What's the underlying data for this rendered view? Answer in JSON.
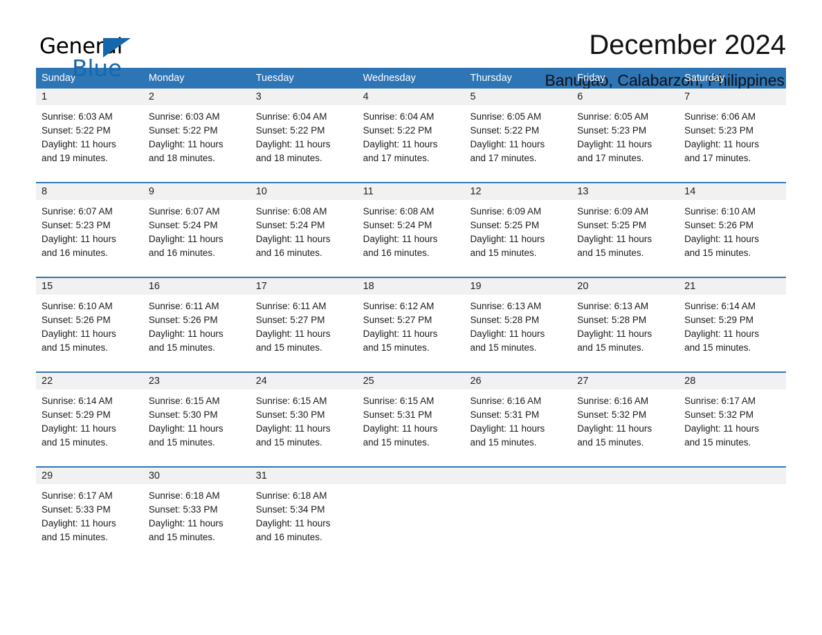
{
  "brand": {
    "name_part1": "General",
    "name_part2": "Blue",
    "triangle_color": "#1567ab",
    "blue_color": "#1569ae"
  },
  "header": {
    "title": "December 2024",
    "location": "Banugao, Calabarzon, Philippines"
  },
  "theme": {
    "header_blue": "#2e75b6",
    "date_band_gray": "#f1f1f1",
    "text_color": "#1a1a1a",
    "page_background": "#ffffff"
  },
  "calendar": {
    "weekdays": [
      "Sunday",
      "Monday",
      "Tuesday",
      "Wednesday",
      "Thursday",
      "Friday",
      "Saturday"
    ],
    "weeks": [
      [
        {
          "day": "1",
          "sunrise": "Sunrise: 6:03 AM",
          "sunset": "Sunset: 5:22 PM",
          "daylight_line1": "Daylight: 11 hours",
          "daylight_line2": "and 19 minutes."
        },
        {
          "day": "2",
          "sunrise": "Sunrise: 6:03 AM",
          "sunset": "Sunset: 5:22 PM",
          "daylight_line1": "Daylight: 11 hours",
          "daylight_line2": "and 18 minutes."
        },
        {
          "day": "3",
          "sunrise": "Sunrise: 6:04 AM",
          "sunset": "Sunset: 5:22 PM",
          "daylight_line1": "Daylight: 11 hours",
          "daylight_line2": "and 18 minutes."
        },
        {
          "day": "4",
          "sunrise": "Sunrise: 6:04 AM",
          "sunset": "Sunset: 5:22 PM",
          "daylight_line1": "Daylight: 11 hours",
          "daylight_line2": "and 17 minutes."
        },
        {
          "day": "5",
          "sunrise": "Sunrise: 6:05 AM",
          "sunset": "Sunset: 5:22 PM",
          "daylight_line1": "Daylight: 11 hours",
          "daylight_line2": "and 17 minutes."
        },
        {
          "day": "6",
          "sunrise": "Sunrise: 6:05 AM",
          "sunset": "Sunset: 5:23 PM",
          "daylight_line1": "Daylight: 11 hours",
          "daylight_line2": "and 17 minutes."
        },
        {
          "day": "7",
          "sunrise": "Sunrise: 6:06 AM",
          "sunset": "Sunset: 5:23 PM",
          "daylight_line1": "Daylight: 11 hours",
          "daylight_line2": "and 17 minutes."
        }
      ],
      [
        {
          "day": "8",
          "sunrise": "Sunrise: 6:07 AM",
          "sunset": "Sunset: 5:23 PM",
          "daylight_line1": "Daylight: 11 hours",
          "daylight_line2": "and 16 minutes."
        },
        {
          "day": "9",
          "sunrise": "Sunrise: 6:07 AM",
          "sunset": "Sunset: 5:24 PM",
          "daylight_line1": "Daylight: 11 hours",
          "daylight_line2": "and 16 minutes."
        },
        {
          "day": "10",
          "sunrise": "Sunrise: 6:08 AM",
          "sunset": "Sunset: 5:24 PM",
          "daylight_line1": "Daylight: 11 hours",
          "daylight_line2": "and 16 minutes."
        },
        {
          "day": "11",
          "sunrise": "Sunrise: 6:08 AM",
          "sunset": "Sunset: 5:24 PM",
          "daylight_line1": "Daylight: 11 hours",
          "daylight_line2": "and 16 minutes."
        },
        {
          "day": "12",
          "sunrise": "Sunrise: 6:09 AM",
          "sunset": "Sunset: 5:25 PM",
          "daylight_line1": "Daylight: 11 hours",
          "daylight_line2": "and 15 minutes."
        },
        {
          "day": "13",
          "sunrise": "Sunrise: 6:09 AM",
          "sunset": "Sunset: 5:25 PM",
          "daylight_line1": "Daylight: 11 hours",
          "daylight_line2": "and 15 minutes."
        },
        {
          "day": "14",
          "sunrise": "Sunrise: 6:10 AM",
          "sunset": "Sunset: 5:26 PM",
          "daylight_line1": "Daylight: 11 hours",
          "daylight_line2": "and 15 minutes."
        }
      ],
      [
        {
          "day": "15",
          "sunrise": "Sunrise: 6:10 AM",
          "sunset": "Sunset: 5:26 PM",
          "daylight_line1": "Daylight: 11 hours",
          "daylight_line2": "and 15 minutes."
        },
        {
          "day": "16",
          "sunrise": "Sunrise: 6:11 AM",
          "sunset": "Sunset: 5:26 PM",
          "daylight_line1": "Daylight: 11 hours",
          "daylight_line2": "and 15 minutes."
        },
        {
          "day": "17",
          "sunrise": "Sunrise: 6:11 AM",
          "sunset": "Sunset: 5:27 PM",
          "daylight_line1": "Daylight: 11 hours",
          "daylight_line2": "and 15 minutes."
        },
        {
          "day": "18",
          "sunrise": "Sunrise: 6:12 AM",
          "sunset": "Sunset: 5:27 PM",
          "daylight_line1": "Daylight: 11 hours",
          "daylight_line2": "and 15 minutes."
        },
        {
          "day": "19",
          "sunrise": "Sunrise: 6:13 AM",
          "sunset": "Sunset: 5:28 PM",
          "daylight_line1": "Daylight: 11 hours",
          "daylight_line2": "and 15 minutes."
        },
        {
          "day": "20",
          "sunrise": "Sunrise: 6:13 AM",
          "sunset": "Sunset: 5:28 PM",
          "daylight_line1": "Daylight: 11 hours",
          "daylight_line2": "and 15 minutes."
        },
        {
          "day": "21",
          "sunrise": "Sunrise: 6:14 AM",
          "sunset": "Sunset: 5:29 PM",
          "daylight_line1": "Daylight: 11 hours",
          "daylight_line2": "and 15 minutes."
        }
      ],
      [
        {
          "day": "22",
          "sunrise": "Sunrise: 6:14 AM",
          "sunset": "Sunset: 5:29 PM",
          "daylight_line1": "Daylight: 11 hours",
          "daylight_line2": "and 15 minutes."
        },
        {
          "day": "23",
          "sunrise": "Sunrise: 6:15 AM",
          "sunset": "Sunset: 5:30 PM",
          "daylight_line1": "Daylight: 11 hours",
          "daylight_line2": "and 15 minutes."
        },
        {
          "day": "24",
          "sunrise": "Sunrise: 6:15 AM",
          "sunset": "Sunset: 5:30 PM",
          "daylight_line1": "Daylight: 11 hours",
          "daylight_line2": "and 15 minutes."
        },
        {
          "day": "25",
          "sunrise": "Sunrise: 6:15 AM",
          "sunset": "Sunset: 5:31 PM",
          "daylight_line1": "Daylight: 11 hours",
          "daylight_line2": "and 15 minutes."
        },
        {
          "day": "26",
          "sunrise": "Sunrise: 6:16 AM",
          "sunset": "Sunset: 5:31 PM",
          "daylight_line1": "Daylight: 11 hours",
          "daylight_line2": "and 15 minutes."
        },
        {
          "day": "27",
          "sunrise": "Sunrise: 6:16 AM",
          "sunset": "Sunset: 5:32 PM",
          "daylight_line1": "Daylight: 11 hours",
          "daylight_line2": "and 15 minutes."
        },
        {
          "day": "28",
          "sunrise": "Sunrise: 6:17 AM",
          "sunset": "Sunset: 5:32 PM",
          "daylight_line1": "Daylight: 11 hours",
          "daylight_line2": "and 15 minutes."
        }
      ],
      [
        {
          "day": "29",
          "sunrise": "Sunrise: 6:17 AM",
          "sunset": "Sunset: 5:33 PM",
          "daylight_line1": "Daylight: 11 hours",
          "daylight_line2": "and 15 minutes."
        },
        {
          "day": "30",
          "sunrise": "Sunrise: 6:18 AM",
          "sunset": "Sunset: 5:33 PM",
          "daylight_line1": "Daylight: 11 hours",
          "daylight_line2": "and 15 minutes."
        },
        {
          "day": "31",
          "sunrise": "Sunrise: 6:18 AM",
          "sunset": "Sunset: 5:34 PM",
          "daylight_line1": "Daylight: 11 hours",
          "daylight_line2": "and 16 minutes."
        },
        {
          "day": "",
          "sunrise": "",
          "sunset": "",
          "daylight_line1": "",
          "daylight_line2": ""
        },
        {
          "day": "",
          "sunrise": "",
          "sunset": "",
          "daylight_line1": "",
          "daylight_line2": ""
        },
        {
          "day": "",
          "sunrise": "",
          "sunset": "",
          "daylight_line1": "",
          "daylight_line2": ""
        },
        {
          "day": "",
          "sunrise": "",
          "sunset": "",
          "daylight_line1": "",
          "daylight_line2": ""
        }
      ]
    ]
  }
}
